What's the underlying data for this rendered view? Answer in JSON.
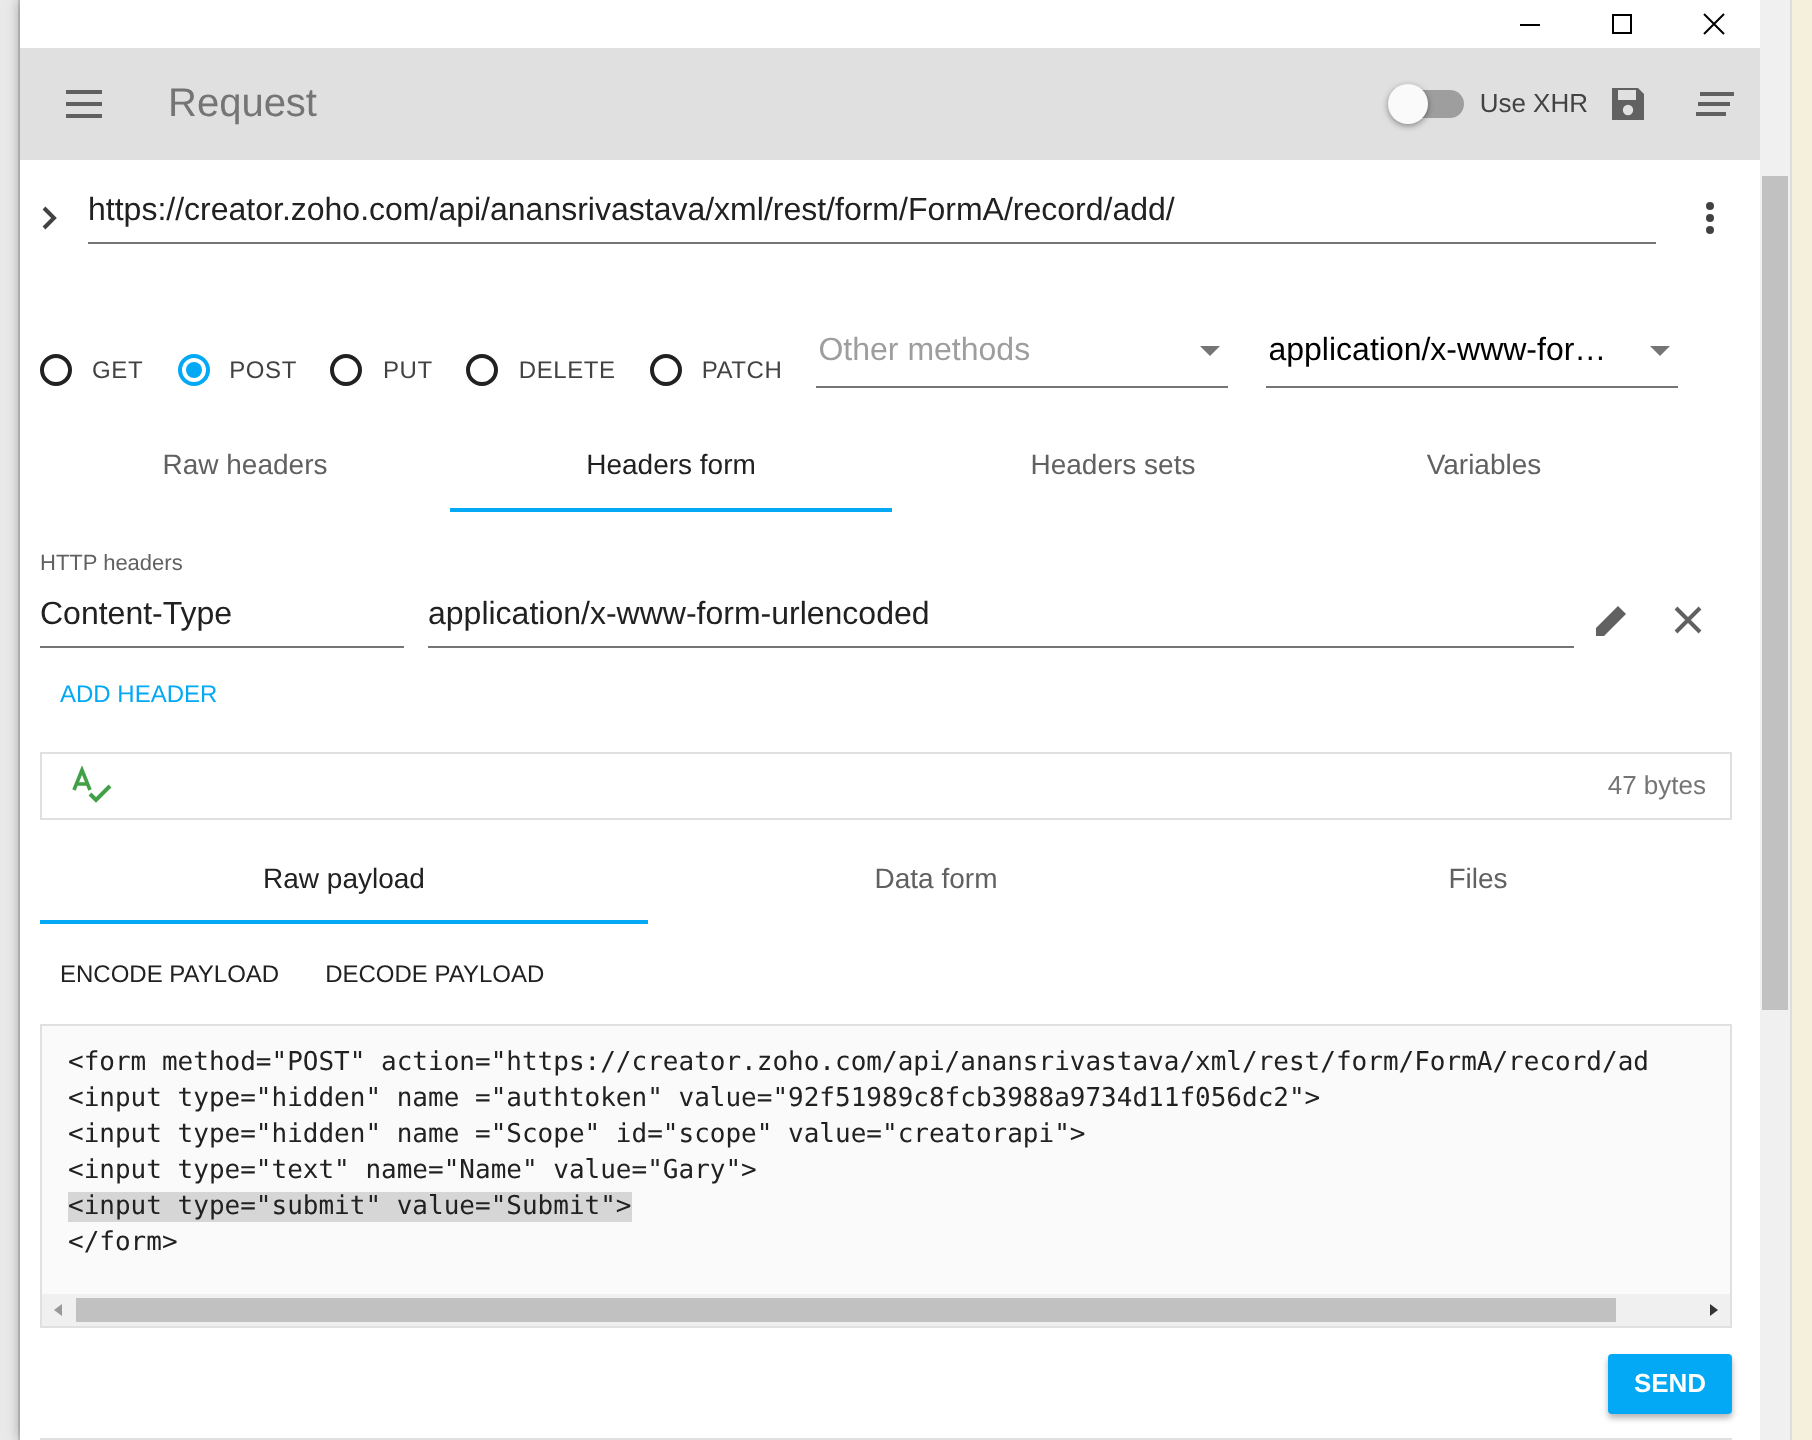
{
  "toolbar": {
    "title": "Request",
    "xhr": {
      "label": "Use XHR",
      "on": false
    }
  },
  "url": {
    "value": "https://creator.zoho.com/api/anansrivastava/xml/rest/form/FormA/record/add/"
  },
  "methods": [
    {
      "label": "GET",
      "selected": false
    },
    {
      "label": "POST",
      "selected": true
    },
    {
      "label": "PUT",
      "selected": false
    },
    {
      "label": "DELETE",
      "selected": false
    },
    {
      "label": "PATCH",
      "selected": false
    }
  ],
  "other_methods": {
    "placeholder": "Other methods"
  },
  "content_type": {
    "value": "application/x-www-for…"
  },
  "header_tabs": [
    {
      "label": "Raw headers",
      "selected": false
    },
    {
      "label": "Headers form",
      "selected": true
    },
    {
      "label": "Headers sets",
      "selected": false
    },
    {
      "label": "Variables",
      "selected": false
    }
  ],
  "headers": {
    "label": "HTTP headers",
    "rows": [
      {
        "name": "Content-Type",
        "value": "application/x-www-form-urlencoded"
      }
    ],
    "add_button": "ADD HEADER"
  },
  "payload_info": {
    "size": "47 bytes"
  },
  "payload_tabs": [
    {
      "label": "Raw payload",
      "selected": true
    },
    {
      "label": "Data form",
      "selected": false
    },
    {
      "label": "Files",
      "selected": false
    }
  ],
  "payload_actions": [
    "ENCODE PAYLOAD",
    "DECODE PAYLOAD"
  ],
  "editor": {
    "lines": [
      {
        "text": "<form method=\"POST\" action=\"https://creator.zoho.com/api/anansrivastava/xml/rest/form/FormA/record/ad",
        "highlighted": false
      },
      {
        "text": "<input type=\"hidden\" name =\"authtoken\" value=\"92f51989c8fcb3988a9734d11f056dc2\">",
        "highlighted": false
      },
      {
        "text": "<input type=\"hidden\" name =\"Scope\" id=\"scope\" value=\"creatorapi\">",
        "highlighted": false
      },
      {
        "text": "<input type=\"text\" name=\"Name\" value=\"Gary\">",
        "highlighted": false
      },
      {
        "text": "<input type=\"submit\" value=\"Submit\">",
        "highlighted": true
      },
      {
        "text": "</form>",
        "highlighted": false
      }
    ]
  },
  "send_button": "SEND"
}
